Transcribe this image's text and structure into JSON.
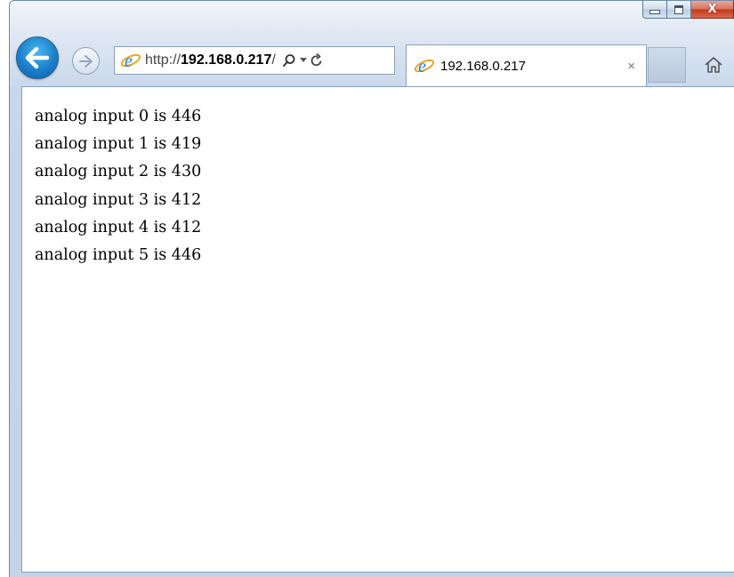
{
  "window": {
    "controls": {
      "minimize": "minimize",
      "maximize": "maximize",
      "close": "close"
    }
  },
  "toolbar": {
    "back_icon": "back-arrow-icon",
    "forward_icon": "forward-arrow-icon",
    "address": {
      "scheme": "http://",
      "host": "192.168.0.217",
      "path": "/",
      "search_icon": "search-icon",
      "dropdown_icon": "chevron-down-icon",
      "refresh_icon": "refresh-icon"
    },
    "tab": {
      "title": "192.168.0.217",
      "close": "×"
    },
    "home_icon": "home-icon"
  },
  "colors": {
    "accent": "#1a7fcc",
    "frame": "#c7d7ea"
  },
  "content": {
    "lines": [
      "analog input 0 is 446",
      "analog input 1 is 419",
      "analog input 2 is 430",
      "analog input 3 is 412",
      "analog input 4 is 412",
      "analog input 5 is 446"
    ]
  }
}
